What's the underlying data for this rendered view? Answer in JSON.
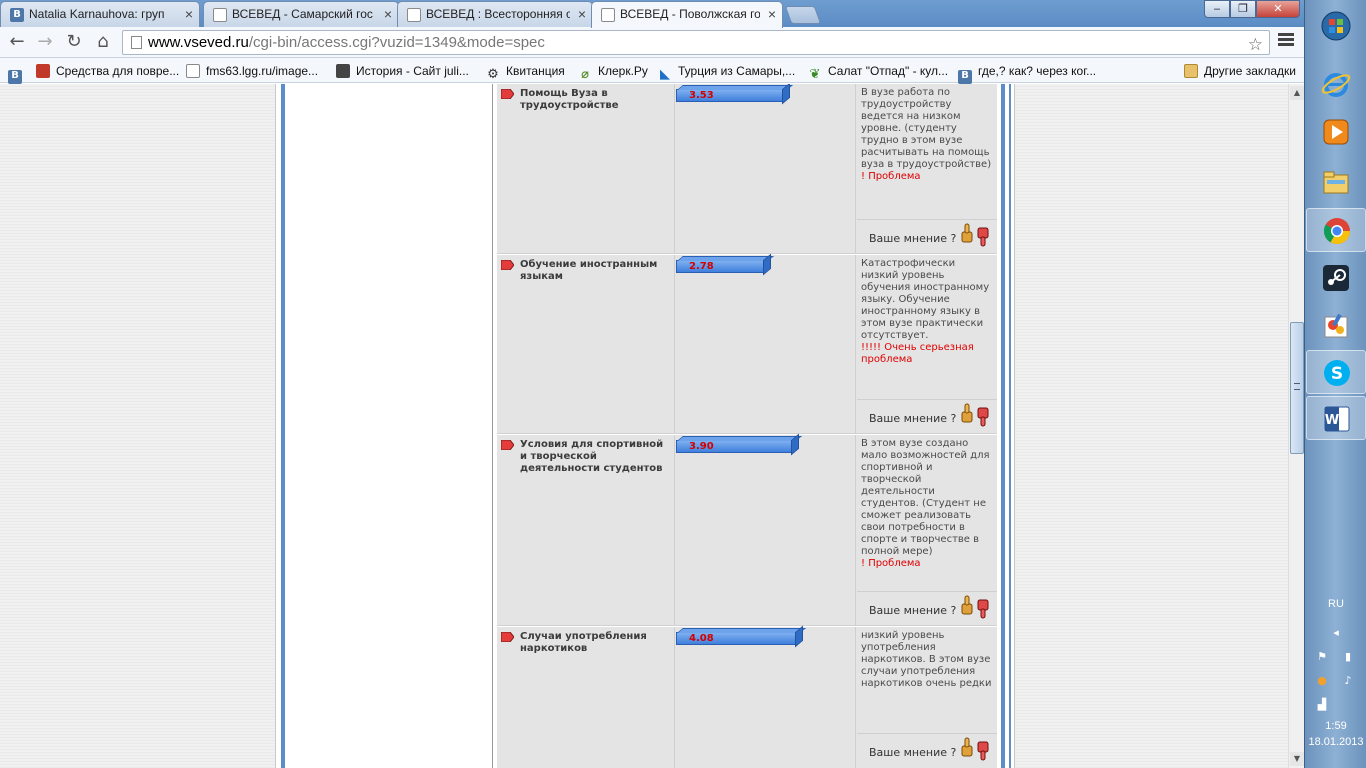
{
  "browser": {
    "tabs": [
      {
        "label": "Natalia Karnauhova: груп",
        "icon": "vk-icon",
        "fav": "В"
      },
      {
        "label": "ВСЕВЕД - Самарский гос",
        "icon": "page-icon",
        "fav": ""
      },
      {
        "label": "ВСЕВЕД : Всесторонняя о",
        "icon": "page-icon",
        "fav": ""
      },
      {
        "label": "ВСЕВЕД - Поволжская го",
        "icon": "page-icon",
        "fav": ""
      }
    ],
    "url_host": "www.vseved.ru",
    "url_path": "/cgi-bin/access.cgi?vuzid=1349&mode=spec",
    "bookmarks": [
      {
        "label": "",
        "icon": "vk-icon"
      },
      {
        "label": "Средства для повре...",
        "icon": "red-box-icon"
      },
      {
        "label": "fms63.lgg.ru/image...",
        "icon": "page-icon"
      },
      {
        "label": "История - Сайт juli...",
        "icon": "wolf-icon"
      },
      {
        "label": "Квитанция",
        "icon": "gear-icon"
      },
      {
        "label": "Клерк.Ру",
        "icon": "paperclip-icon"
      },
      {
        "label": "Турция из Самары,...",
        "icon": "plane-icon"
      },
      {
        "label": "Салат \"Отпад\" - кул...",
        "icon": "leaf-icon"
      },
      {
        "label": "где,? как? через ког...",
        "icon": "vk-icon"
      }
    ],
    "other_bookmarks": "Другие закладки"
  },
  "rows": [
    {
      "name": "Помощь Вуза в трудоустройстве",
      "score": "3.53",
      "score_value": 3.53,
      "desc": "В вузе работа по трудоустройству ведется на низком уровне. (студенту трудно в этом вузе расчитывать на помощь вуза в трудоустройстве)",
      "problem": "! Проблема",
      "opinion": "Ваше мнение ?"
    },
    {
      "name": "Обучение иностранным языкам",
      "score": "2.78",
      "score_value": 2.78,
      "desc": "Катастрофически низкий уровень обучения иностранному языку. Обучение иностранному языку в этом вузе практически отсутствует.",
      "problem": "!!!!! Очень серьезная проблема",
      "opinion": "Ваше мнение ?"
    },
    {
      "name": "Условия для спортивной и творческой деятельности студентов",
      "score": "3.90",
      "score_value": 3.9,
      "desc": "В этом вузе создано мало возможностей для спортивной и творческой деятельности студентов. (Студент не сможет реализовать свои потребности в спорте и творчестве в полной мере)",
      "problem": "! Проблема",
      "opinion": "Ваше мнение ?"
    },
    {
      "name": "Случаи употребления наркотиков",
      "score": "4.08",
      "score_value": 4.08,
      "desc": "низкий уровень употребления наркотиков. В этом вузе случаи употребления наркотиков очень редки",
      "problem": "",
      "opinion": "Ваше мнение ?"
    }
  ],
  "taskbar": {
    "apps": [
      "windows-start-icon",
      "ie-icon",
      "media-player-icon",
      "explorer-icon",
      "chrome-icon",
      "steam-icon",
      "paint-icon",
      "skype-icon",
      "word-icon"
    ],
    "lang": "RU",
    "time": "1:59",
    "date": "18.01.2013"
  }
}
